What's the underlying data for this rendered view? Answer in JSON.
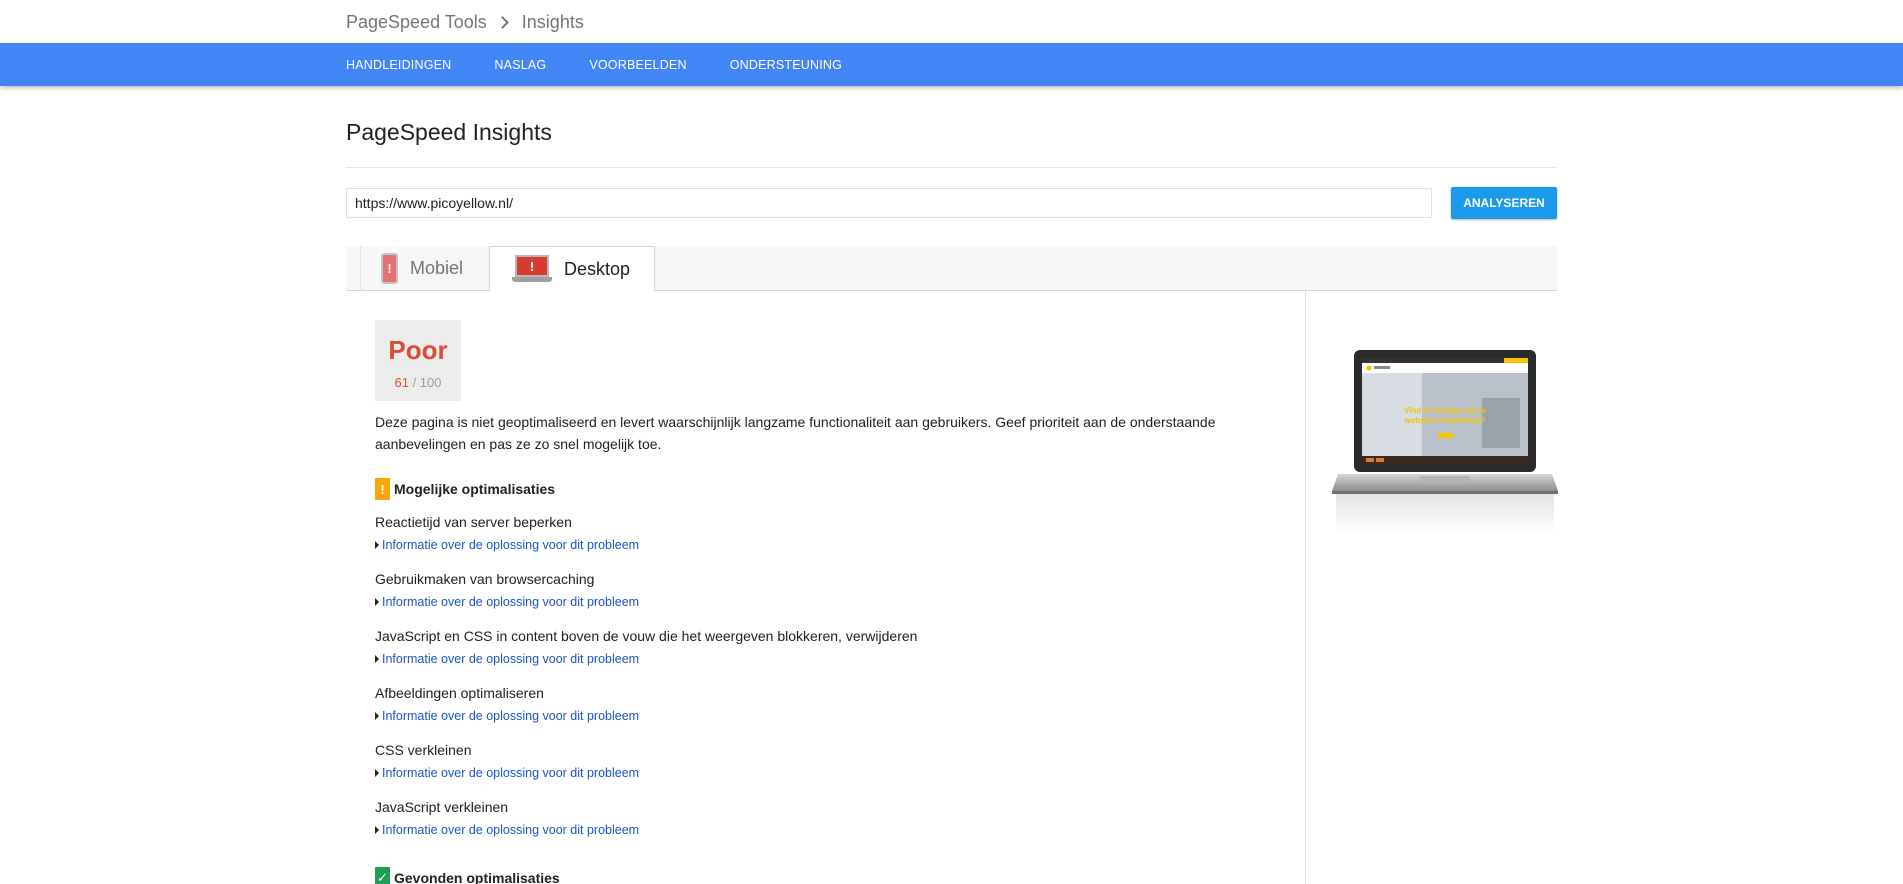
{
  "breadcrumb": {
    "parent": "PageSpeed Tools",
    "current": "Insights"
  },
  "nav": {
    "items": [
      "HANDLEIDINGEN",
      "NASLAG",
      "VOORBEELDEN",
      "ONDERSTEUNING"
    ]
  },
  "page": {
    "title": "PageSpeed Insights"
  },
  "search": {
    "value": "https://www.picoyellow.nl/",
    "button_label": "ANALYSEREN"
  },
  "tabs": {
    "mobile": "Mobiel",
    "desktop": "Desktop",
    "active": "desktop"
  },
  "score": {
    "verdict": "Poor",
    "value": "61",
    "max": "/ 100",
    "color": "#dd4b39"
  },
  "summary": "Deze pagina is niet geoptimaliseerd en levert waarschijnlijk langzame functionaliteit aan gebruikers. Geef prioriteit aan de onderstaande aanbevelingen en pas ze zo snel mogelijk toe.",
  "possible": {
    "heading": "Mogelijke optimalisaties",
    "icon": "warning-icon",
    "items": [
      {
        "title": "Reactietijd van server beperken",
        "link": "Informatie over de oplossing voor dit probleem"
      },
      {
        "title": "Gebruikmaken van browsercaching",
        "link": "Informatie over de oplossing voor dit probleem"
      },
      {
        "title": "JavaScript en CSS in content boven de vouw die het weergeven blokkeren, verwijderen",
        "link": "Informatie over de oplossing voor dit probleem"
      },
      {
        "title": "Afbeeldingen optimaliseren",
        "link": "Informatie over de oplossing voor dit probleem"
      },
      {
        "title": "CSS verkleinen",
        "link": "Informatie over de oplossing voor dit probleem"
      },
      {
        "title": "JavaScript verkleinen",
        "link": "Informatie over de oplossing voor dit probleem"
      }
    ]
  },
  "found": {
    "heading": "Gevonden optimalisaties",
    "icon": "checkmark-icon"
  },
  "preview": {
    "icon": "laptop-screenshot-icon",
    "headline_line1": "Vind  in Google met je",
    "headline_line2": "website of webshop?"
  },
  "colors": {
    "nav_bar": "#4285f4",
    "button": "#1a9ae8",
    "poor": "#dd4b39",
    "warning": "#fba50b",
    "ok": "#1f9d55",
    "link": "#1a55c4"
  }
}
